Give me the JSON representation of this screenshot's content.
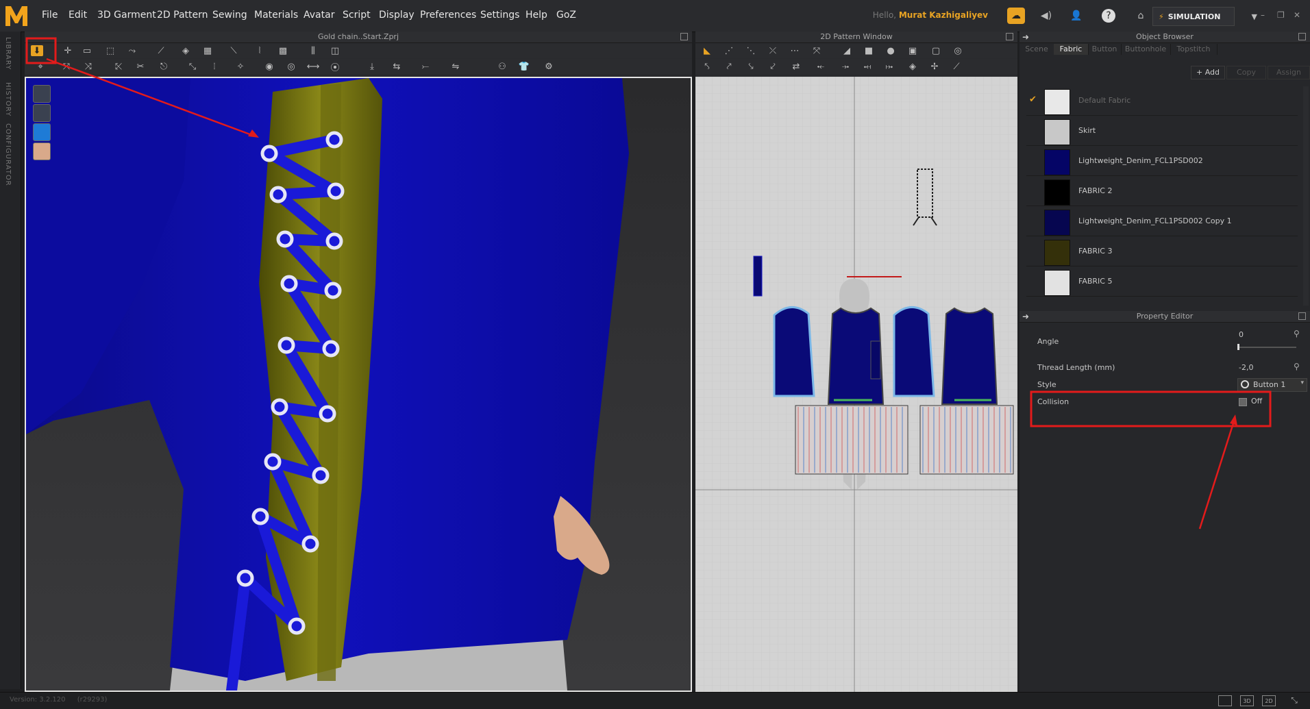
{
  "menu": {
    "items": [
      "File",
      "Edit",
      "3D Garment",
      "2D Pattern",
      "Sewing",
      "Materials",
      "Avatar",
      "Script",
      "Display",
      "Preferences",
      "Settings",
      "Help",
      "GoZ"
    ],
    "greeting_hello": "Hello,",
    "greeting_user": "Murat Kazhigaliyev",
    "mode_label": "SIMULATION"
  },
  "left_tabs": [
    "LIBRARY",
    "HISTORY",
    "CONFIGURATOR"
  ],
  "panel3d": {
    "title": "Gold chain..Start.Zprj"
  },
  "panel2d": {
    "title": "2D Pattern Window"
  },
  "object_browser": {
    "title": "Object Browser",
    "tabs": [
      "Scene",
      "Fabric",
      "Button",
      "Buttonhole",
      "Topstitch"
    ],
    "active_tab": "Fabric",
    "actions": {
      "add": "Add",
      "copy": "Copy",
      "assign": "Assign"
    },
    "fabrics": [
      {
        "name": "Default Fabric",
        "color": "#e8e8e8",
        "checked": true
      },
      {
        "name": "Skirt",
        "color": "#c8c8c8",
        "checked": false
      },
      {
        "name": "Lightweight_Denim_FCL1PSD002",
        "color": "#050566",
        "checked": false
      },
      {
        "name": "FABRIC 2",
        "color": "#000000",
        "checked": false
      },
      {
        "name": "Lightweight_Denim_FCL1PSD002 Copy 1",
        "color": "#060650",
        "checked": false
      },
      {
        "name": "FABRIC 3",
        "color": "#34300a",
        "checked": false
      },
      {
        "name": "FABRIC 5",
        "color": "#e2e2e2",
        "checked": false
      }
    ]
  },
  "property_editor": {
    "title": "Property Editor",
    "angle_label": "Angle",
    "angle_value": "0",
    "thread_label": "Thread Length (mm)",
    "thread_value": "-2,0",
    "style_label": "Style",
    "style_value": "Button 1",
    "collision_label": "Collision",
    "collision_value": "Off"
  },
  "status": {
    "version": "Version: 3.2.120",
    "build": "(r29293)"
  },
  "colors": {
    "accent": "#e8a323",
    "annotation": "#e31b1b",
    "garment_blue": "#0c0ca8",
    "garment_gold": "#6b6a0c"
  }
}
